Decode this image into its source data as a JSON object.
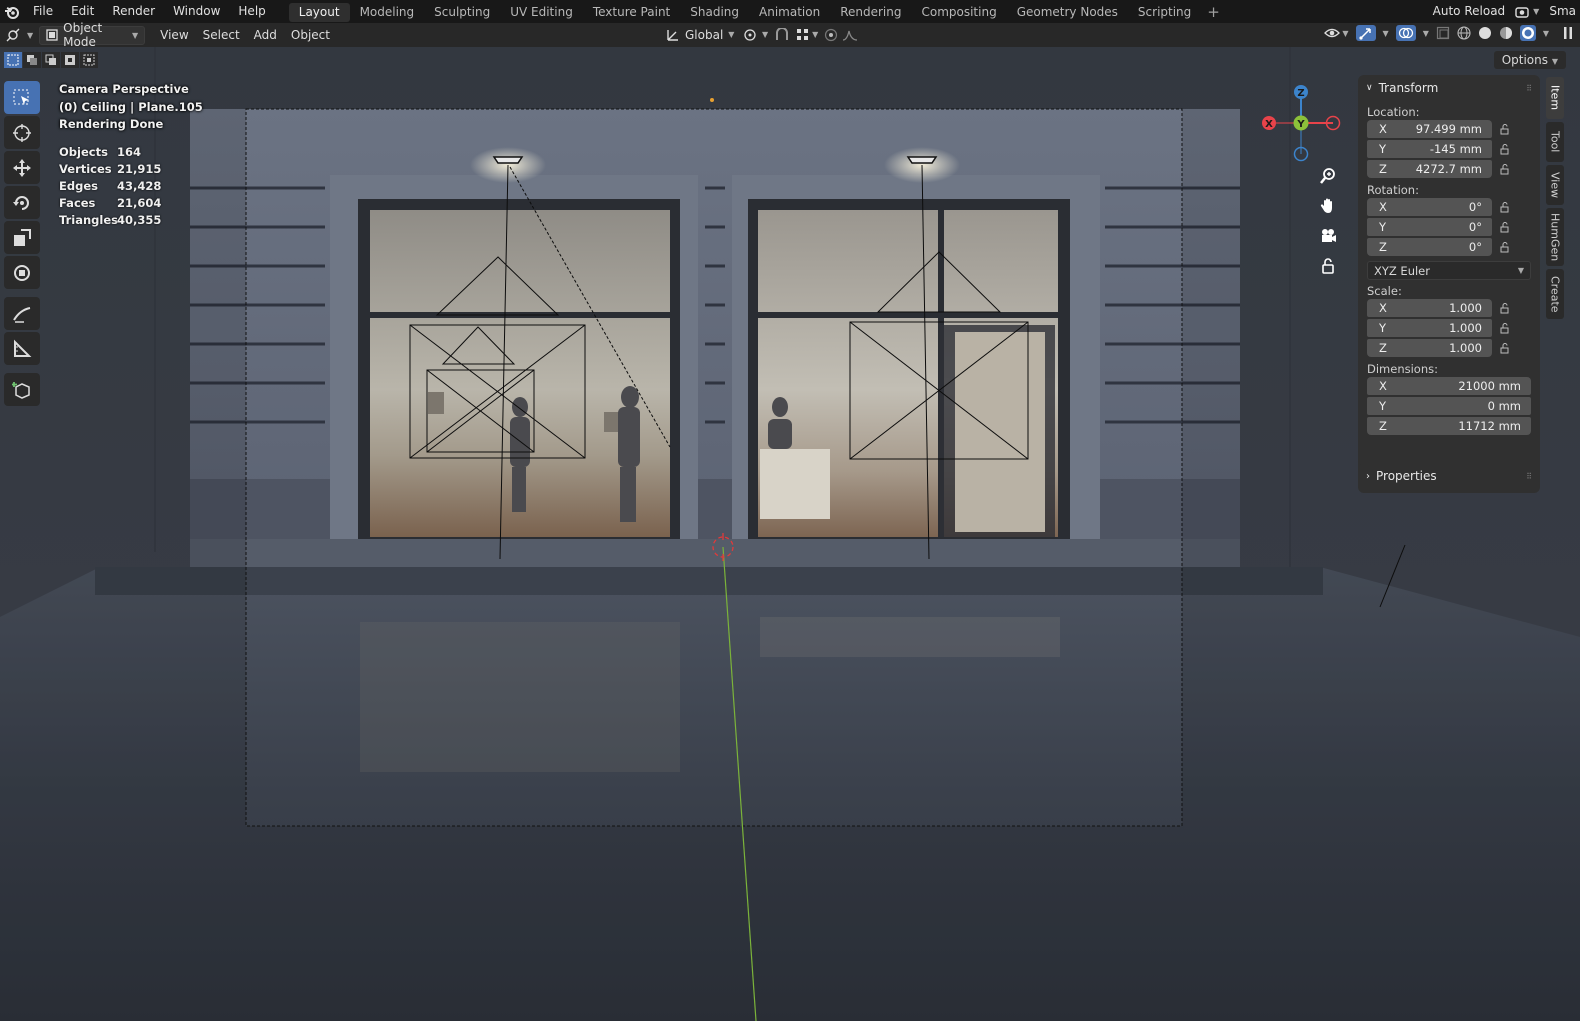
{
  "topbar": {
    "menus": [
      "File",
      "Edit",
      "Render",
      "Window",
      "Help"
    ],
    "workspaces": [
      "Layout",
      "Modeling",
      "Sculpting",
      "UV Editing",
      "Texture Paint",
      "Shading",
      "Animation",
      "Rendering",
      "Compositing",
      "Geometry Nodes",
      "Scripting"
    ],
    "active_workspace": "Layout",
    "add_tab": "+",
    "auto_reload": "Auto Reload",
    "scene_label": "Sma"
  },
  "header": {
    "mode": "Object Mode",
    "menus": [
      "View",
      "Select",
      "Add",
      "Object"
    ],
    "orientation": "Global",
    "options": "Options"
  },
  "overlay": {
    "view_name": "Camera Perspective",
    "collection": "(0) Ceiling | Plane.105",
    "status": "Rendering Done",
    "stats": [
      {
        "label": "Objects",
        "value": "164"
      },
      {
        "label": "Vertices",
        "value": "21,915"
      },
      {
        "label": "Edges",
        "value": "43,428"
      },
      {
        "label": "Faces",
        "value": "21,604"
      },
      {
        "label": "Triangles",
        "value": "40,355"
      }
    ]
  },
  "gizmo": {
    "x": "X",
    "y": "Y",
    "z": "Z"
  },
  "npanel": {
    "transform_title": "Transform",
    "location_label": "Location:",
    "location": [
      {
        "axis": "X",
        "value": "97.499 mm"
      },
      {
        "axis": "Y",
        "value": "-145 mm"
      },
      {
        "axis": "Z",
        "value": "4272.7 mm"
      }
    ],
    "rotation_label": "Rotation:",
    "rotation": [
      {
        "axis": "X",
        "value": "0°"
      },
      {
        "axis": "Y",
        "value": "0°"
      },
      {
        "axis": "Z",
        "value": "0°"
      }
    ],
    "rotation_mode": "XYZ Euler",
    "scale_label": "Scale:",
    "scale": [
      {
        "axis": "X",
        "value": "1.000"
      },
      {
        "axis": "Y",
        "value": "1.000"
      },
      {
        "axis": "Z",
        "value": "1.000"
      }
    ],
    "dimensions_label": "Dimensions:",
    "dimensions": [
      {
        "axis": "X",
        "value": "21000 mm"
      },
      {
        "axis": "Y",
        "value": "0 mm"
      },
      {
        "axis": "Z",
        "value": "11712 mm"
      }
    ],
    "properties_title": "Properties"
  },
  "side_tabs": [
    "Item",
    "Tool",
    "View",
    "HumGen",
    "Create"
  ],
  "colors": {
    "accent": "#4772b3",
    "axis_x": "#e8434a",
    "axis_y": "#8cc13a",
    "axis_z": "#3c84cc"
  }
}
